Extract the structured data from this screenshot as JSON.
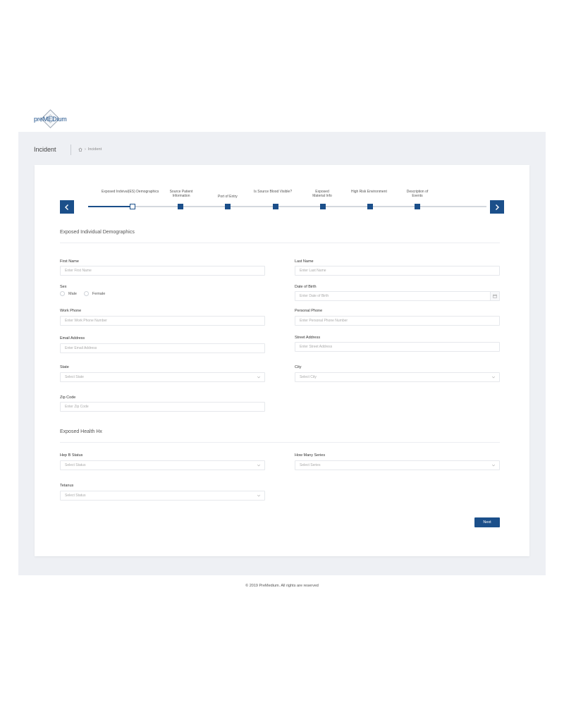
{
  "brand": {
    "name": "preMEDium"
  },
  "header": {
    "title": "Incident",
    "breadcrumb": "Incident"
  },
  "stepper": {
    "steps": [
      "Exposed Indvival(ES) Demographics",
      "Source Patient Information",
      "Port of Entry",
      "Is Source Blood Visible?",
      "Exposed Material Info",
      "High Risk Environment",
      "Description of Events"
    ],
    "current_step": 1
  },
  "demographics": {
    "title": "Exposed Individual Demographics",
    "first_name": {
      "label": "First Name",
      "placeholder": "Enter First Name"
    },
    "last_name": {
      "label": "Last Name",
      "placeholder": "Enter Last Name"
    },
    "sex": {
      "label": "Sex",
      "options": [
        "Male",
        "Female"
      ]
    },
    "dob": {
      "label": "Date of Birth",
      "placeholder": "Enter Date of Birth"
    },
    "work_phone": {
      "label": "Work Phone",
      "placeholder": "Enter Work  Phone Number"
    },
    "personal_phone": {
      "label": "Personal Phone",
      "placeholder": "Enter Personal Phone Number"
    },
    "email": {
      "label": "Email Address",
      "placeholder": "Enter Email Address"
    },
    "street": {
      "label": "Street Address",
      "placeholder": "Enter Street Address"
    },
    "state": {
      "label": "State",
      "placeholder": "Select State"
    },
    "city": {
      "label": "City",
      "placeholder": "Select City"
    },
    "zip": {
      "label": "Zip Code",
      "placeholder": "Enter Zip Code"
    }
  },
  "health": {
    "title": "Exposed Health Hx",
    "hep_b": {
      "label": "Hep B Status",
      "placeholder": "Select Status"
    },
    "series": {
      "label": "How Many Series",
      "placeholder": "Select Series"
    },
    "tetanus": {
      "label": "Tetanus",
      "placeholder": "Select Status"
    }
  },
  "actions": {
    "next": "Next"
  },
  "footer": {
    "text": "© 2019 PreMedium. All rights are reserved"
  },
  "colors": {
    "primary": "#1b4f8a",
    "band": "#eef0f4"
  }
}
